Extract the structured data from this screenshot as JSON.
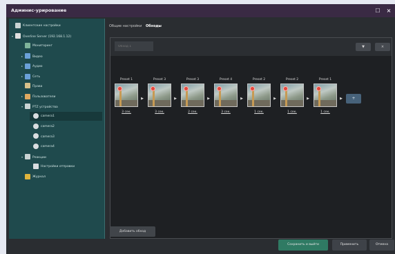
{
  "window": {
    "title": "Админис-урирование",
    "maximize_glyph": "☐",
    "close_glyph": "×"
  },
  "sidebar": {
    "items": [
      {
        "label": "Клиентские настройки",
        "icon": "gear-icon",
        "twisty": ""
      },
      {
        "label": "Overline Server (192.168.1.12)",
        "icon": "server-icon",
        "twisty": "▾"
      },
      {
        "label": "Мониторинг",
        "icon": "monitor-icon",
        "twisty": ""
      },
      {
        "label": "Видео",
        "icon": "video-icon",
        "twisty": "▸"
      },
      {
        "label": "Аудио",
        "icon": "audio-icon",
        "twisty": "▸"
      },
      {
        "label": "Сеть",
        "icon": "network-icon",
        "twisty": "▸"
      },
      {
        "label": "Права",
        "icon": "users-icon",
        "twisty": ""
      },
      {
        "label": "Пользователи",
        "icon": "user-icon",
        "twisty": "▸"
      },
      {
        "label": "PTZ устройства",
        "icon": "ptz-icon",
        "twisty": "▾"
      },
      {
        "label": "camera1",
        "icon": "camera-icon",
        "twisty": ""
      },
      {
        "label": "camera2",
        "icon": "camera-icon",
        "twisty": ""
      },
      {
        "label": "camera3",
        "icon": "camera-icon",
        "twisty": ""
      },
      {
        "label": "camera4",
        "icon": "camera-icon",
        "twisty": ""
      },
      {
        "label": "Реакции",
        "icon": "reactions-icon",
        "twisty": "▾"
      },
      {
        "label": "Настройки отправки",
        "icon": "send-icon",
        "twisty": ""
      },
      {
        "label": "Журнал",
        "icon": "journal-icon",
        "twisty": ""
      }
    ]
  },
  "tabs": {
    "general": "Общие настройки",
    "tours": "Обходы"
  },
  "tour": {
    "name_placeholder": "Обход 1",
    "filter_button": "▼",
    "remove_button": "×",
    "add_preset_button": "+",
    "presets": [
      {
        "label": "Preset 1",
        "duration": "3 сек."
      },
      {
        "label": "Preset 3",
        "duration": "3 сек."
      },
      {
        "label": "Preset 3",
        "duration": "2 сек."
      },
      {
        "label": "Preset 4",
        "duration": "3 сек."
      },
      {
        "label": "Preset 2",
        "duration": "1 сек."
      },
      {
        "label": "Preset 2",
        "duration": "1 сек."
      },
      {
        "label": "Preset 1",
        "duration": "1 сек."
      }
    ],
    "arrow_glyph": "▶"
  },
  "buttons": {
    "add_tour": "Добавить обход",
    "save_exit": "Сохранить и выйти",
    "apply": "Применить",
    "cancel": "Отмена"
  },
  "colors": {
    "sidebar_bg": "#1f4a4d",
    "titlebar_bg": "#3a2a44",
    "save_button": "#2f7a63",
    "preset_marker": "#e3473c"
  }
}
